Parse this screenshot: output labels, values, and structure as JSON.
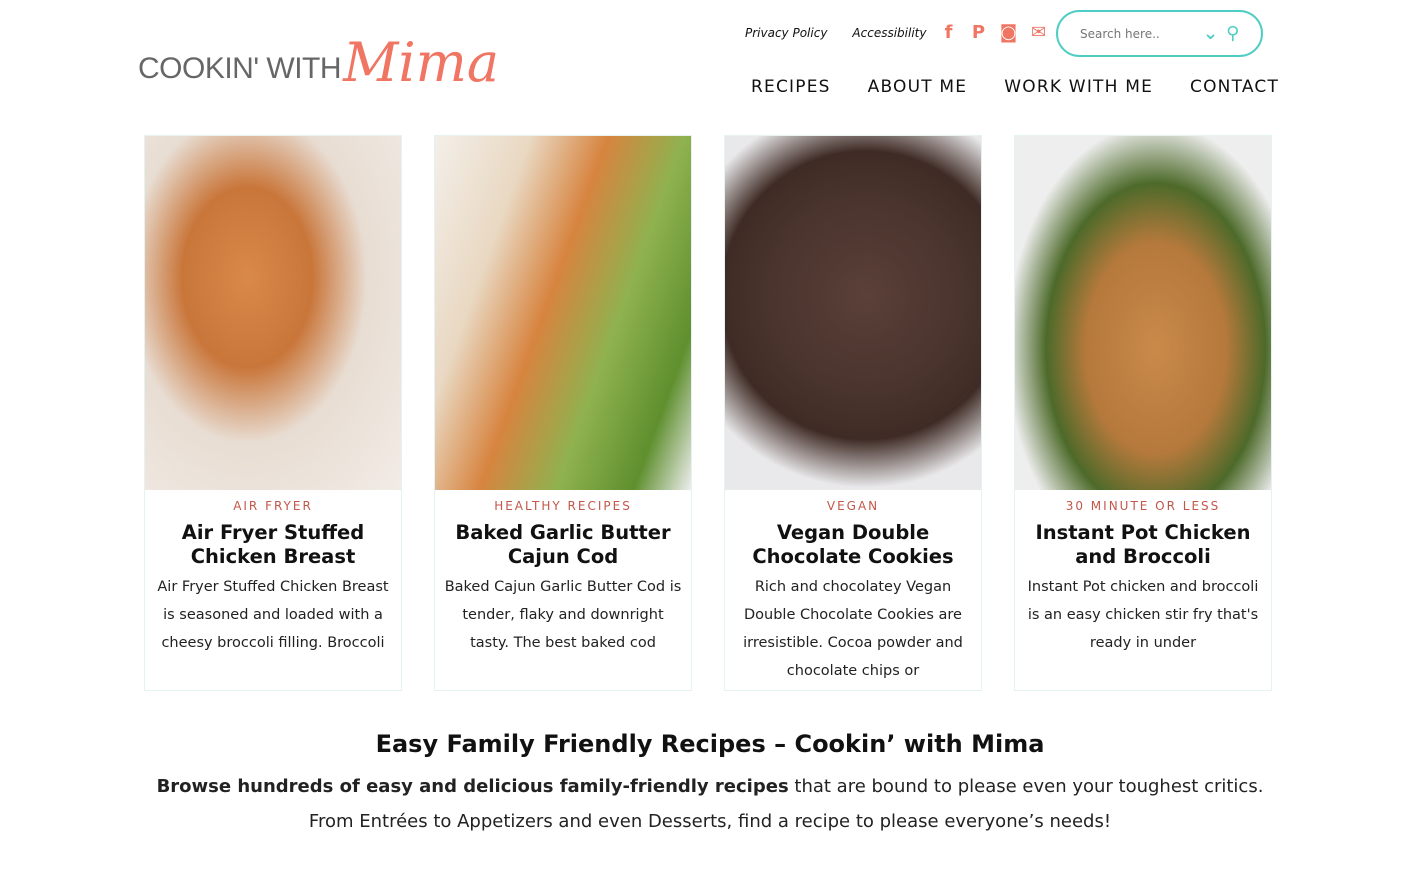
{
  "logo": {
    "text_a": "COOKIN' WITH",
    "text_b": "Mima"
  },
  "utility": {
    "privacy": "Privacy Policy",
    "accessibility": "Accessibility"
  },
  "social": [
    "facebook-icon",
    "pinterest-icon",
    "instagram-icon",
    "email-icon"
  ],
  "search": {
    "placeholder": "Search here.."
  },
  "nav": [
    "RECIPES",
    "ABOUT ME",
    "WORK WITH ME",
    "CONTACT"
  ],
  "colors": {
    "accent": "#f07563",
    "teal": "#4ecdc4",
    "category": "#c3574a"
  },
  "cards": [
    {
      "category": "AIR FRYER",
      "title": "Air Fryer Stuffed Chicken Breast",
      "desc": "Air Fryer Stuffed Chicken Breast is seasoned and loaded with a cheesy broccoli filling. Broccoli"
    },
    {
      "category": "HEALTHY RECIPES",
      "title": "Baked Garlic Butter Cajun Cod",
      "desc": "Baked Cajun Garlic Butter Cod is tender, flaky and downright tasty. The best baked cod"
    },
    {
      "category": "VEGAN",
      "title": "Vegan Double Chocolate Cookies",
      "desc": "Rich and chocolatey Vegan Double Chocolate Cookies are irresistible. Cocoa powder and chocolate chips or"
    },
    {
      "category": "30 MINUTE OR LESS",
      "title": "Instant Pot Chicken and Broccoli",
      "desc": "Instant Pot chicken and broccoli is an easy chicken stir fry that's ready in under"
    }
  ],
  "intro": {
    "heading": "Easy Family Friendly Recipes – Cookin’ with Mima",
    "bold": "Browse hundreds of easy and delicious family-friendly recipes",
    "rest": " that are bound to please even your toughest critics.",
    "line2": "From Entrées to Appetizers and even Desserts, find a recipe to please everyone’s needs!"
  }
}
